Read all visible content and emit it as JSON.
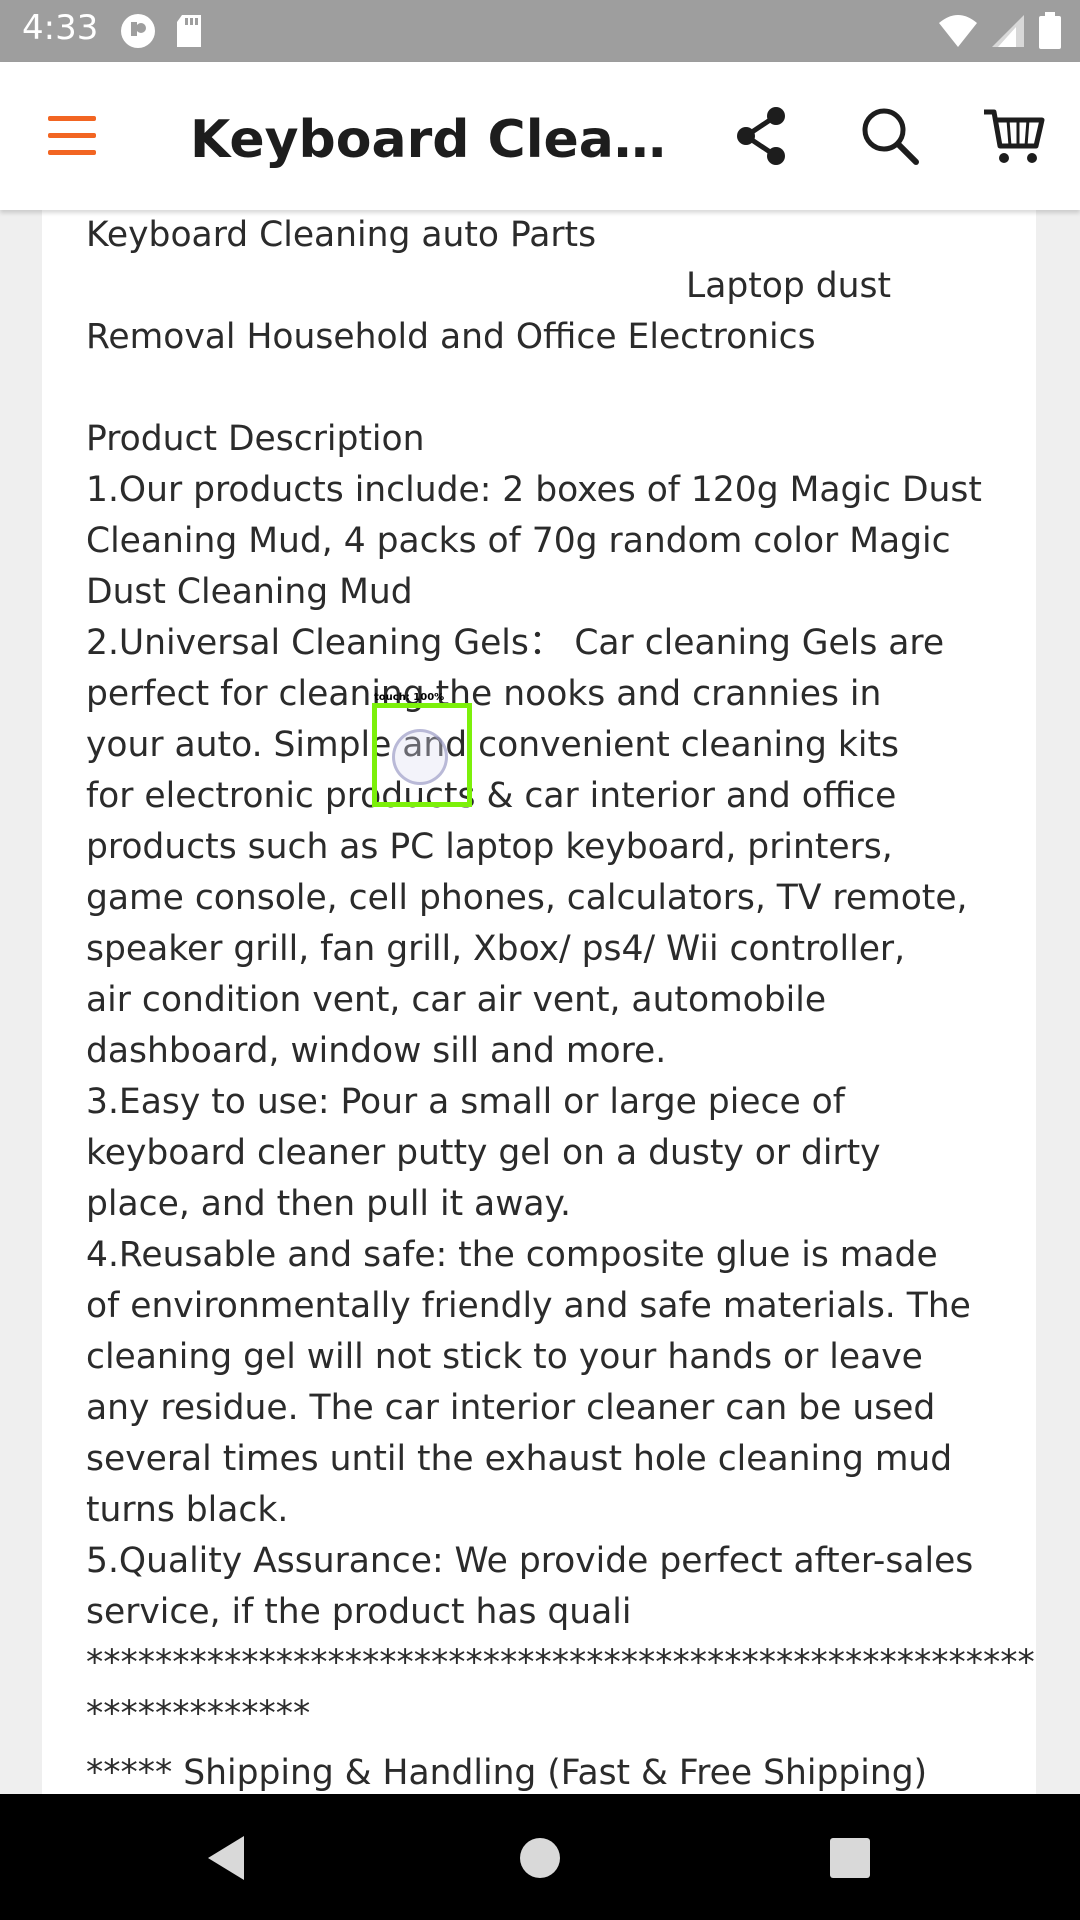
{
  "status_bar": {
    "time": "4:33"
  },
  "app_bar": {
    "title": "Keyboard Cleane...",
    "accent_color": "#f26522"
  },
  "description": {
    "lines": [
      "Keyboard Cleaning auto Parts",
      "Laptop dust",
      "Removal Household and Office Electronics",
      "",
      "Product Description",
      "1.Our products include: 2 boxes of 120g Magic Dust",
      "Cleaning Mud, 4 packs of 70g random color Magic",
      "Dust Cleaning Mud",
      "2.Universal Cleaning Gels： Car cleaning Gels are",
      "perfect for cleaning the nooks and crannies in",
      "your auto. Simple and convenient cleaning kits",
      "for electronic products & car interior and office",
      "products such as PC laptop keyboard, printers,",
      "game console, cell phones, calculators, TV remote,",
      "speaker grill, fan grill, Xbox/ ps4/ Wii controller,",
      "air condition vent, car air vent, automobile",
      "dashboard, window sill and more.",
      "3.Easy to use: Pour a small or large piece of",
      "keyboard cleaner putty gel on a dusty or dirty",
      "place, and then pull it away.",
      "4.Reusable and safe: the composite glue is made",
      "of environmentally friendly and safe materials. The",
      "cleaning gel will not stick to your hands or leave",
      "any residue. The car interior cleaner can be used",
      "several times until the exhaust hole cleaning mud",
      "turns black.",
      "5.Quality Assurance: We provide perfect after-sales",
      "service, if the product has quali",
      "*******************************************************",
      "*************",
      "***** Shipping & Handling (Fast & Free Shipping)"
    ]
  },
  "touch_indicator": {
    "label": "touch: 100%"
  }
}
